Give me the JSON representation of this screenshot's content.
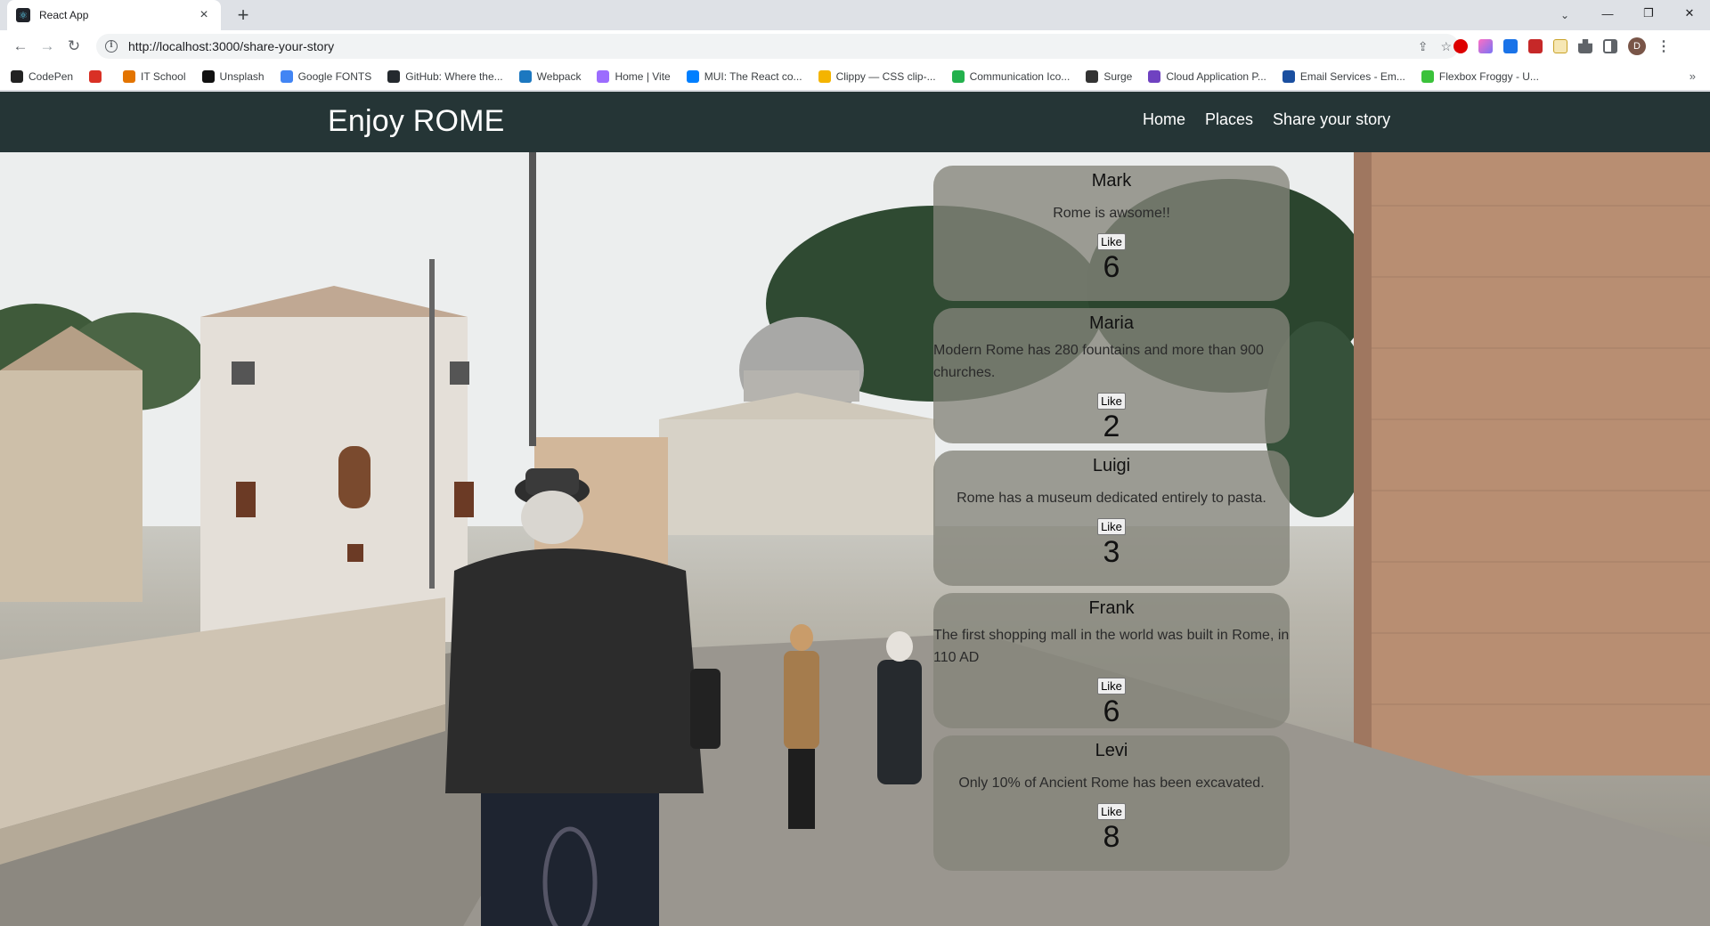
{
  "browser": {
    "tab_title": "React App",
    "url": "http://localhost:3000/share-your-story",
    "bookmarks": [
      {
        "label": "CodePen",
        "color": "#222222"
      },
      {
        "label": "",
        "color": "#d93025"
      },
      {
        "label": "IT School",
        "color": "#e37400"
      },
      {
        "label": "Unsplash",
        "color": "#111111"
      },
      {
        "label": "Google FONTS",
        "color": "#4285f4"
      },
      {
        "label": "GitHub: Where the...",
        "color": "#24292e"
      },
      {
        "label": "Webpack",
        "color": "#1c78c0"
      },
      {
        "label": "Home | Vite",
        "color": "#9c6cfe"
      },
      {
        "label": "MUI: The React co...",
        "color": "#007fff"
      },
      {
        "label": "Clippy — CSS clip-...",
        "color": "#f4b400"
      },
      {
        "label": "Communication Ico...",
        "color": "#23b14d"
      },
      {
        "label": "Surge",
        "color": "#333333"
      },
      {
        "label": "Cloud Application P...",
        "color": "#6f42c1"
      },
      {
        "label": "Email Services - Em...",
        "color": "#1a4fa0"
      },
      {
        "label": "Flexbox Froggy - U...",
        "color": "#3ac23a"
      }
    ],
    "profile_initial": "D"
  },
  "site": {
    "brand": "Enjoy ROME",
    "nav": [
      "Home",
      "Places",
      "Share your story"
    ]
  },
  "stories": [
    {
      "name": "Mark",
      "text": "Rome is awsome!!",
      "button": "Like",
      "likes": "6"
    },
    {
      "name": "Maria",
      "text": "Modern Rome has 280 fountains and more than 900 churches.",
      "button": "Like",
      "likes": "2"
    },
    {
      "name": "Luigi",
      "text": "Rome has a museum dedicated entirely to pasta.",
      "button": "Like",
      "likes": "3"
    },
    {
      "name": "Frank",
      "text": "The first shopping mall in the world was built in Rome, in 110 AD",
      "button": "Like",
      "likes": "6"
    },
    {
      "name": "Levi",
      "text": "Only 10% of Ancient Rome has been excavated.",
      "button": "Like",
      "likes": "8"
    }
  ]
}
